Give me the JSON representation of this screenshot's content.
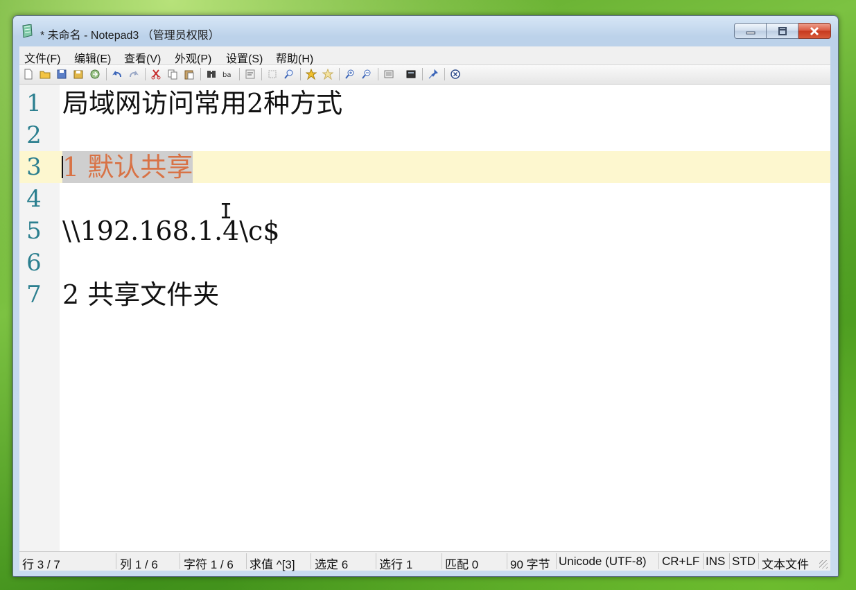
{
  "window": {
    "title": "* 未命名 - Notepad3 （管理员权限）"
  },
  "menu": [
    "文件(F)",
    "编辑(E)",
    "查看(V)",
    "外观(P)",
    "设置(S)",
    "帮助(H)"
  ],
  "toolbar_icons": [
    "new-file-icon",
    "open-folder-icon",
    "save-icon",
    "save-as-icon",
    "browse-icon",
    "undo-icon",
    "redo-icon",
    "cut-icon",
    "copy-icon",
    "paste-icon",
    "find-icon",
    "replace-icon",
    "word-wrap-icon",
    "select-icon",
    "zoom-find-icon",
    "add-favorite-icon",
    "favorites-icon",
    "zoom-in-icon",
    "zoom-out-icon",
    "schemes-icon",
    "customize-icon",
    "always-on-top-icon",
    "exit-icon"
  ],
  "editor": {
    "lines": [
      {
        "number": "1",
        "text": "局域网访问常用2种方式"
      },
      {
        "number": "2",
        "text": ""
      },
      {
        "number": "3",
        "text": "1 默认共享",
        "selected": true
      },
      {
        "number": "4",
        "text": ""
      },
      {
        "number": "5",
        "text": "\\\\192.168.1.4\\c$"
      },
      {
        "number": "6",
        "text": ""
      },
      {
        "number": "7",
        "text": "2 共享文件夹"
      }
    ],
    "current_line": 3,
    "selection_color": "#d87245",
    "line_number_color": "#2b7f8f",
    "current_line_bg": "#fdf7cf"
  },
  "status": {
    "line": "行 3 / 7",
    "col": "列 1 / 6",
    "char": "字符 1 / 6",
    "value": "求值 ^[3]",
    "selected": "选定 6",
    "sel_lines": "选行 1",
    "match": "匹配 0",
    "bytes": "90 字节",
    "encoding": "Unicode (UTF-8)",
    "eol": "CR+LF",
    "ins": "INS",
    "std": "STD",
    "type": "文本文件"
  }
}
